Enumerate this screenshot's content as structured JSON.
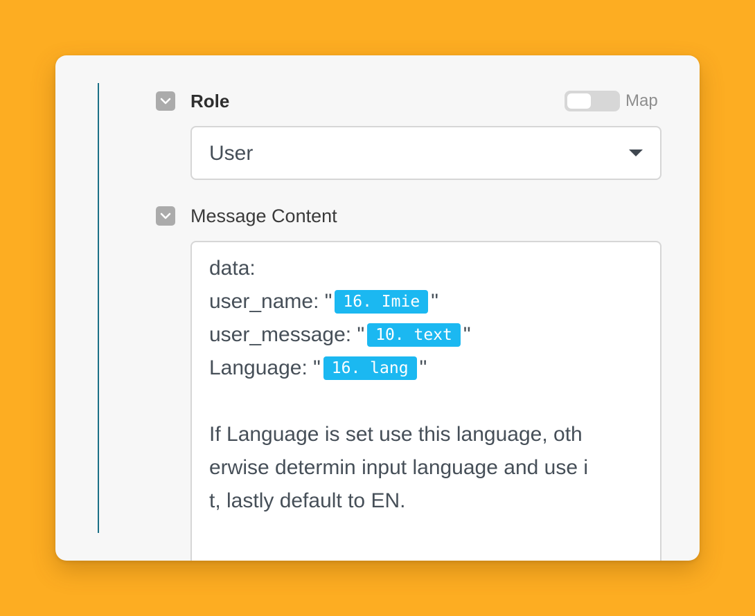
{
  "role": {
    "label": "Role",
    "map_label": "Map",
    "map_toggle_on": false,
    "selected_value": "User"
  },
  "message_content": {
    "label": "Message Content",
    "lines": [
      {
        "prefix": "data:",
        "pill": "",
        "suffix": ""
      },
      {
        "prefix": "user_name: \"",
        "pill": "16. Imie",
        "suffix": "\""
      },
      {
        "prefix": "user_message: \"",
        "pill": "10. text",
        "suffix": "\""
      },
      {
        "prefix": "Language: \"",
        "pill": "16. lang",
        "suffix": "\""
      },
      {
        "prefix": "",
        "pill": "",
        "suffix": ""
      },
      {
        "prefix": "If Language is set use this language, oth",
        "pill": "",
        "suffix": ""
      },
      {
        "prefix": "erwise determin input language and use i",
        "pill": "",
        "suffix": ""
      },
      {
        "prefix": "t, lastly default to EN.",
        "pill": "",
        "suffix": ""
      }
    ]
  },
  "colors": {
    "background": "#FDAD22",
    "card": "#F7F7F7",
    "accent_line": "#1A6F86",
    "pill": "#1BB8F1",
    "chevron_button": "#ABABAB"
  },
  "icons": {
    "role_collapse": "chevron-down-icon",
    "message_collapse": "chevron-down-icon",
    "select_caret": "caret-down-icon"
  }
}
